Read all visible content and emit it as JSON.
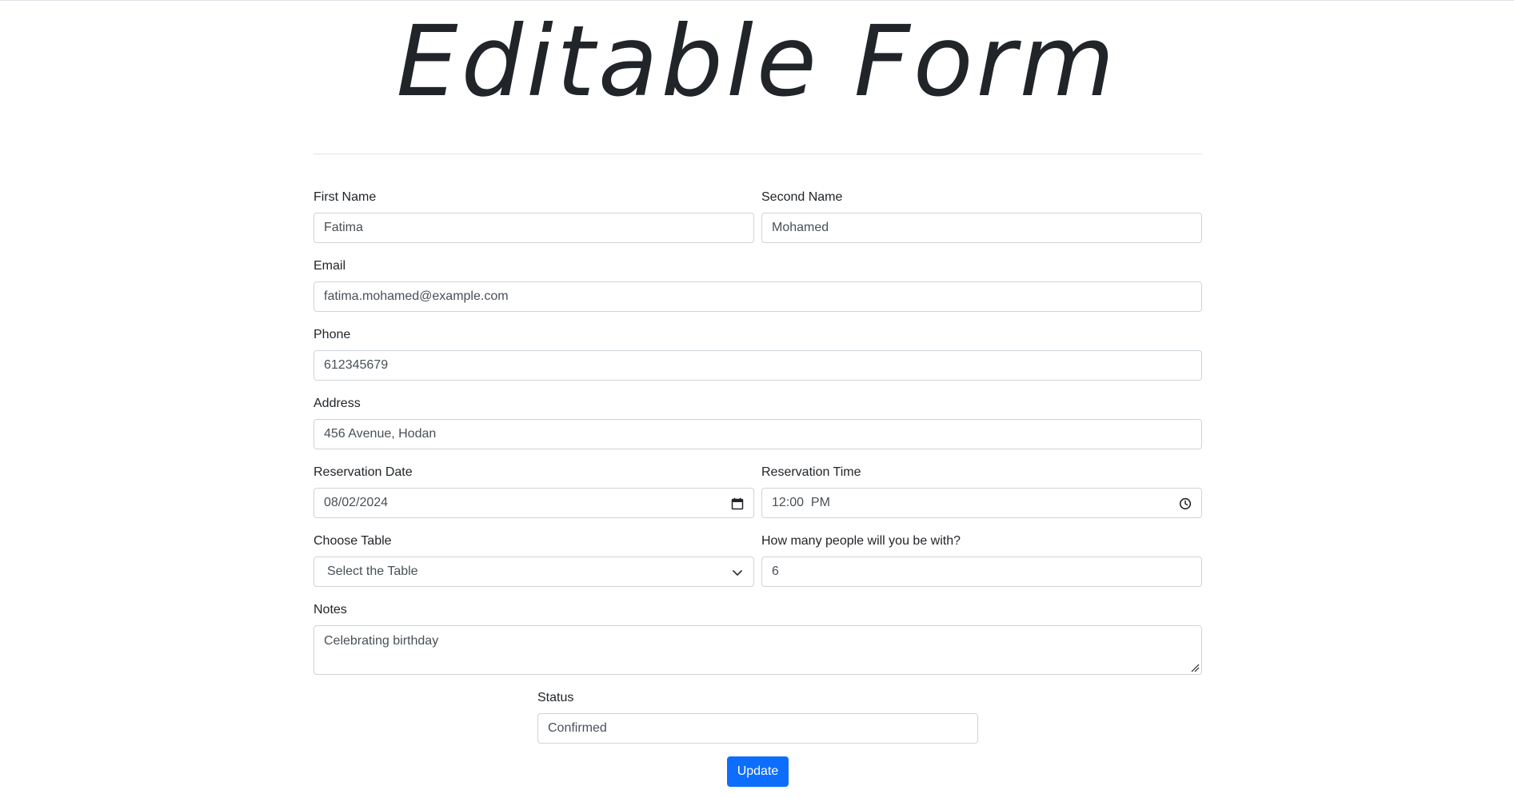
{
  "page": {
    "title": "Editable Form"
  },
  "form": {
    "first_name": {
      "label": "First Name",
      "value": "Fatima"
    },
    "second_name": {
      "label": "Second Name",
      "value": "Mohamed"
    },
    "email": {
      "label": "Email",
      "value": "fatima.mohamed@example.com"
    },
    "phone": {
      "label": "Phone",
      "value": "612345679"
    },
    "address": {
      "label": "Address",
      "value": "456 Avenue, Hodan"
    },
    "reservation_date": {
      "label": "Reservation Date",
      "value": "08/02/2024",
      "icon": "calendar-icon"
    },
    "reservation_time": {
      "label": "Reservation Time",
      "value": "12:00  PM",
      "icon": "clock-icon"
    },
    "choose_table": {
      "label": "Choose Table",
      "selected": "Select the Table",
      "icon": "chevron-down-icon"
    },
    "people": {
      "label": "How many people will you be with?",
      "value": "6"
    },
    "notes": {
      "label": "Notes",
      "value": "Celebrating birthday"
    },
    "status": {
      "label": "Status",
      "value": "Confirmed"
    },
    "submit_label": "Update"
  },
  "colors": {
    "primary": "#0d6efd",
    "border": "#ced4da",
    "text": "#212529",
    "input_text": "#495057"
  }
}
